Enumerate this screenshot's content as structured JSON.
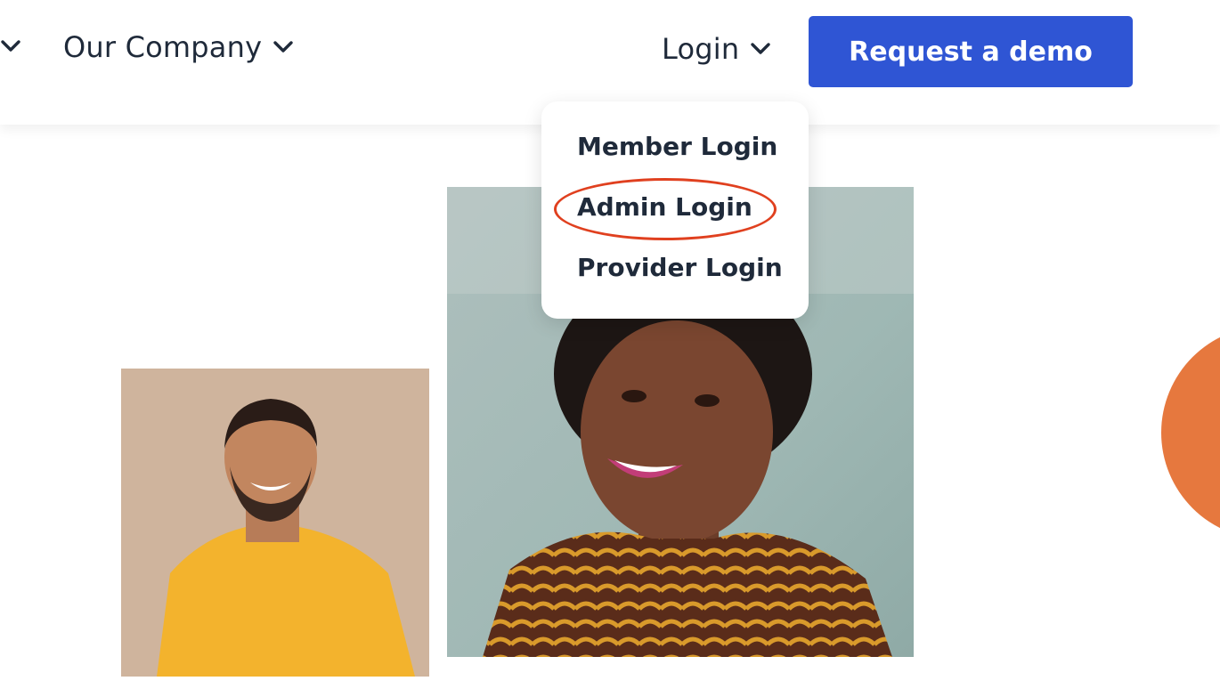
{
  "header": {
    "nav": {
      "our_company_label": "Our Company",
      "login_label": "Login"
    },
    "cta": {
      "request_demo_label": "Request a demo"
    }
  },
  "login_menu": {
    "items": [
      "Member Login",
      "Admin Login",
      "Provider Login"
    ],
    "highlighted_item": "Admin Login"
  },
  "colors": {
    "brand_blue": "#2f55d4",
    "text_dark": "#1f2a3a",
    "accent_orange": "#e6783e",
    "highlight_red": "#e0401f"
  },
  "icons": [
    "chevron-down-icon"
  ],
  "images": [
    "man-in-yellow-shirt-photo",
    "smiling-woman-photo"
  ]
}
